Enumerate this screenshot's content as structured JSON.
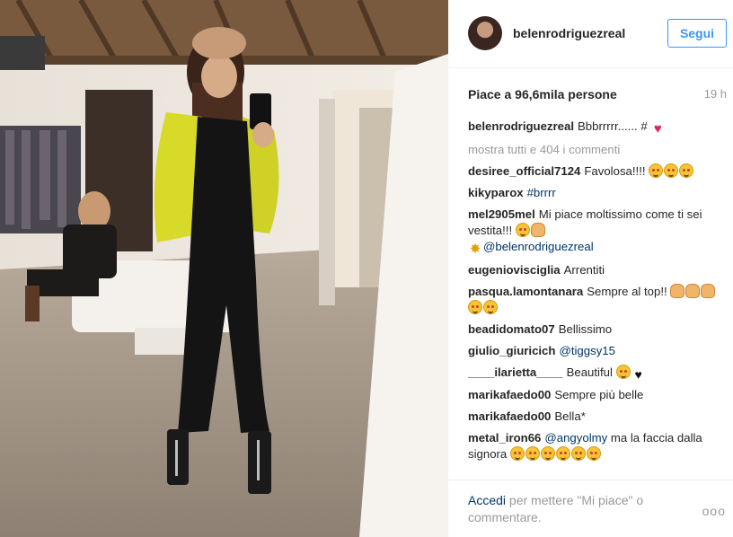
{
  "post": {
    "username": "belenrodriguezreal",
    "follow_label": "Segui",
    "likes_text": "Piace a 96,6mila persone",
    "time_ago": "19 h",
    "show_all_comments": "mostra tutti e 404 i commenti"
  },
  "comments": [
    {
      "user": "belenrodriguezreal",
      "text": "Bbbrrrrr...... #",
      "emojis": [
        "heart"
      ]
    },
    {
      "user": "desiree_official7124",
      "text": "Favolosa!!!!",
      "emojis": [
        "heart-eyes-face",
        "heart-eyes-face",
        "heart-eyes-face"
      ]
    },
    {
      "user": "kikyparox",
      "tag": "#brrrr"
    },
    {
      "user": "mel2905mel",
      "text": "Mi piace moltissimo come ti sei vestita!!!",
      "emojis": [
        "grin-face",
        "thumbs-up"
      ],
      "mention": "@belenrodriguezreal"
    },
    {
      "user": "eugeniovisciglia",
      "text": "Arrentiti"
    },
    {
      "user": "pasqua.lamontanara",
      "text": "Sempre al top!!",
      "emojis": [
        "thumbs-up",
        "clap",
        "clap",
        "smile-face",
        "smile-face"
      ]
    },
    {
      "user": "beadidomato07",
      "text": "Bellissimo"
    },
    {
      "user": "giulio_giuricich",
      "tag": "@tiggsy15"
    },
    {
      "user": "____ilarietta____",
      "text": "Beautiful",
      "emojis": [
        "smile-face",
        "black-heart"
      ]
    },
    {
      "user": "marikafaedo00",
      "text": "Sempre più belle"
    },
    {
      "user": "marikafaedo00",
      "text": "Bella*"
    },
    {
      "user": "metal_iron66",
      "tag": "@angyolmy",
      "text": "ma la faccia dalla signora",
      "emojis": [
        "smile-face",
        "smile-face",
        "smile-face",
        "smile-face",
        "smile-face",
        "smile-face"
      ]
    }
  ],
  "footer": {
    "login_link": "Accedi",
    "login_rest": "per mettere \"Mi piace\" o commentare.",
    "more_label": "ooo"
  },
  "colors": {
    "link_blue": "#3897f0",
    "tag_dark_blue": "#003569",
    "muted_gray": "#999999",
    "cardigan_yellow": "#d8da2a"
  }
}
